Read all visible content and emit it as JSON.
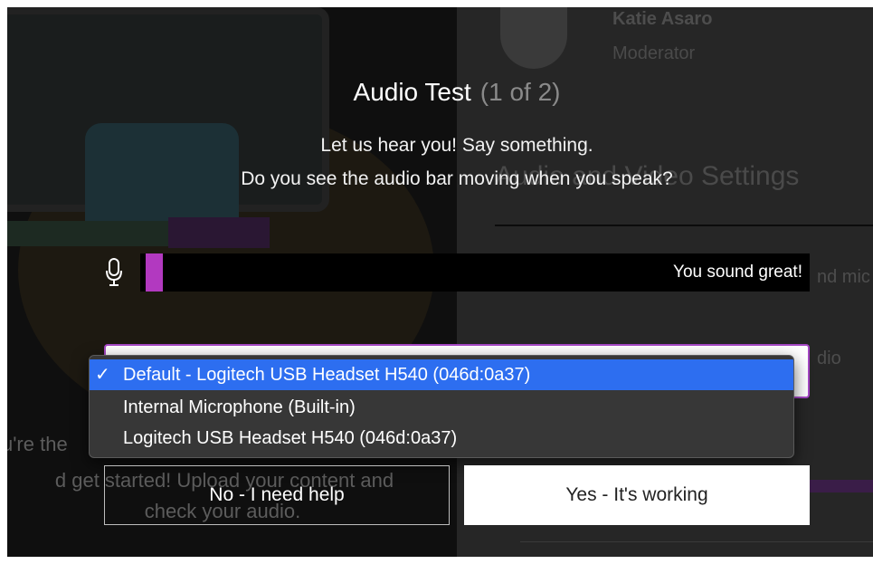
{
  "moderator": {
    "name": "Katie Asaro",
    "role": "Moderator"
  },
  "background": {
    "intro_line1": "u're the",
    "intro_line2": "d get started! Upload your content and",
    "intro_line3": "check your audio.",
    "settings_heading": "Audio and Video Settings",
    "settings_mic_fragment": "nd mic",
    "settings_audio_fragment": "dio"
  },
  "dialog": {
    "title": "Audio Test",
    "step": "(1 of 2)",
    "prompt_line1": "Let us hear you! Say something.",
    "prompt_line2": "Do you see the audio bar moving when you speak?",
    "meter": {
      "level_fraction": 0.025,
      "fill_color": "#b239c0",
      "status": "You sound great!",
      "icon": "microphone-icon"
    },
    "microphone_options": [
      {
        "label": "Default - Logitech USB Headset H540 (046d:0a37)",
        "selected": true,
        "check": "✓"
      },
      {
        "label": "Internal Microphone (Built-in)",
        "selected": false,
        "check": ""
      },
      {
        "label": "Logitech USB Headset H540 (046d:0a37)",
        "selected": false,
        "check": ""
      }
    ],
    "buttons": {
      "no_label": "No - I need help",
      "yes_label": "Yes - It's working"
    }
  },
  "colors": {
    "accent_purple": "#b239c0",
    "dropdown_highlight": "#2d6ef0"
  }
}
